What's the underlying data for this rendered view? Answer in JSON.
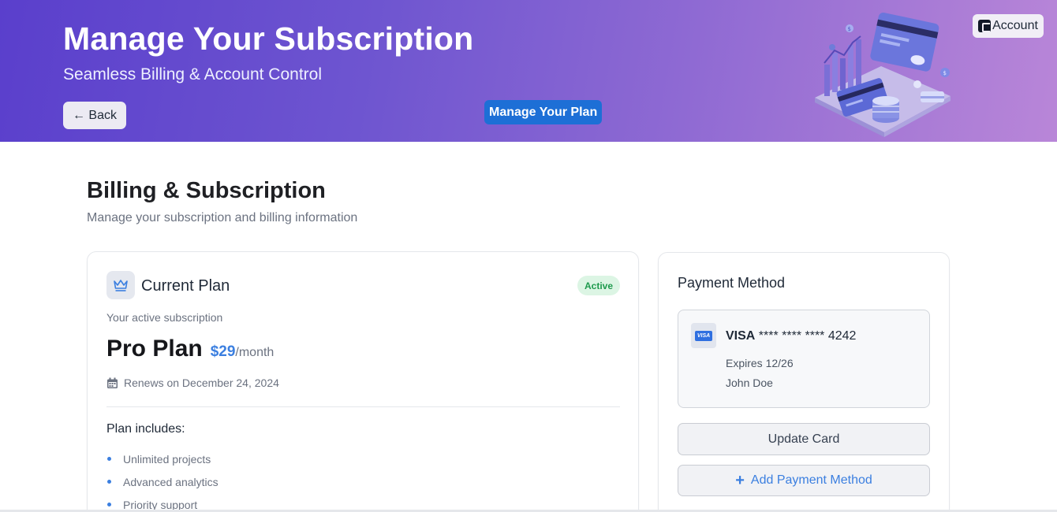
{
  "header": {
    "title": "Manage Your Subscription",
    "subtitle": "Seamless Billing & Account Control",
    "back_label": "← Back",
    "manage_plan_label": "Manage Your Plan",
    "account_label": "Account"
  },
  "billing": {
    "title": "Billing & Subscription",
    "subtitle": "Manage your subscription and billing information"
  },
  "plan": {
    "heading": "Current Plan",
    "status": "Active",
    "subheading": "Your active subscription",
    "name": "Pro Plan",
    "price": "$29",
    "period": "/month",
    "renewal": "Renews on December 24, 2024",
    "includes_title": "Plan includes:",
    "features": [
      "Unlimited projects",
      "Advanced analytics",
      "Priority support"
    ]
  },
  "payment": {
    "title": "Payment Method",
    "brand": "VISA",
    "card_number": "**** **** **** 4242",
    "expiry": "Expires 12/26",
    "holder": "John Doe",
    "badge_text": "VISA",
    "update_label": "Update Card",
    "add_label": "Add Payment Method"
  },
  "colors": {
    "header_gradient_start": "#5a3fcc",
    "header_gradient_end": "#b986d8",
    "accent_blue": "#3b7fe0",
    "primary_button": "#1d6fd6",
    "active_badge_bg": "#dcf5e4",
    "active_badge_text": "#1e9a4d"
  },
  "icons": {
    "plan": "crown-icon",
    "renewal": "calendar-icon",
    "add": "plus-icon",
    "account": "wallet-icon"
  }
}
